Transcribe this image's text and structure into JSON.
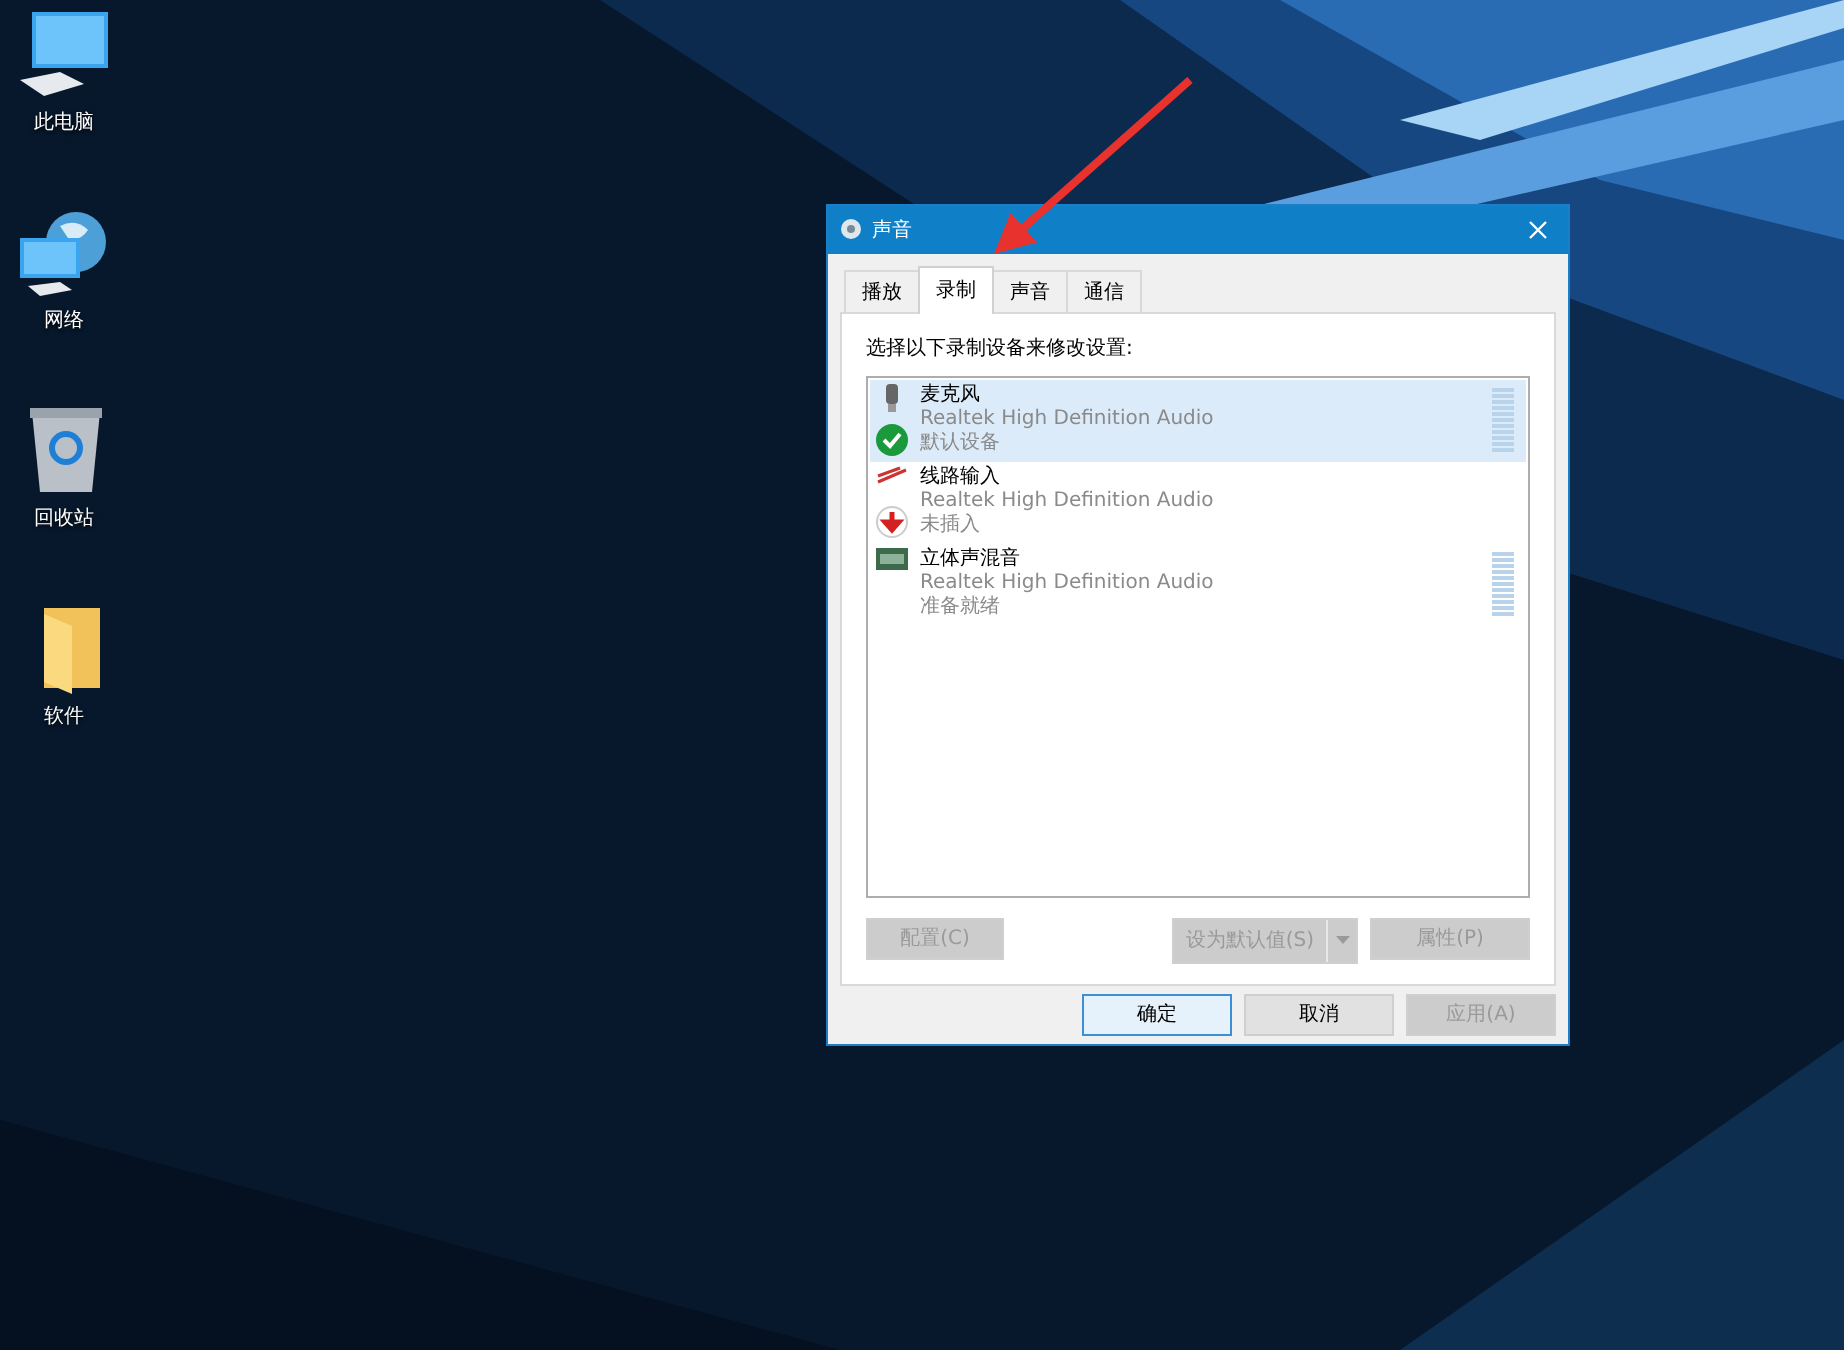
{
  "desktop_icons": [
    {
      "label": "此电脑",
      "kind": "computer"
    },
    {
      "label": "网络",
      "kind": "network"
    },
    {
      "label": "回收站",
      "kind": "recycle"
    },
    {
      "label": "软件",
      "kind": "folder"
    }
  ],
  "dialog": {
    "title": "声音",
    "tabs": [
      {
        "label": "播放",
        "selected": false
      },
      {
        "label": "录制",
        "selected": true
      },
      {
        "label": "声音",
        "selected": false
      },
      {
        "label": "通信",
        "selected": false
      }
    ],
    "instruction": "选择以下录制设备来修改设置:",
    "devices": [
      {
        "name": "麦克风",
        "driver": "Realtek High Definition Audio",
        "status": "默认设备",
        "kind": "mic",
        "default": true,
        "unplugged": false,
        "selected": true,
        "meter": true
      },
      {
        "name": "线路输入",
        "driver": "Realtek High Definition Audio",
        "status": "未插入",
        "kind": "line",
        "default": false,
        "unplugged": true,
        "selected": false,
        "meter": false
      },
      {
        "name": "立体声混音",
        "driver": "Realtek High Definition Audio",
        "status": "准备就绪",
        "kind": "mix",
        "default": false,
        "unplugged": false,
        "selected": false,
        "meter": true
      }
    ],
    "actions": [
      {
        "label": "配置(C)",
        "kind": "plain",
        "disabled": true
      },
      {
        "label": "设为默认值(S)",
        "kind": "split",
        "disabled": true
      },
      {
        "label": "属性(P)",
        "kind": "plain",
        "disabled": true
      }
    ],
    "footer": [
      {
        "label": "确定",
        "disabled": false,
        "default": true
      },
      {
        "label": "取消",
        "disabled": false,
        "default": false
      },
      {
        "label": "应用(A)",
        "disabled": true,
        "default": false
      }
    ]
  }
}
